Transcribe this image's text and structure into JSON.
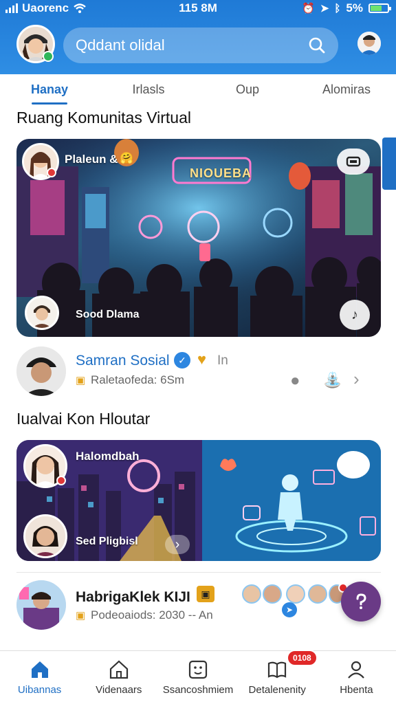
{
  "status_bar": {
    "carrier": "Uaorenc",
    "time": "115 8M",
    "battery": "5%"
  },
  "header": {
    "search_placeholder": "Qddant olidal"
  },
  "tabs": [
    {
      "label": "Hanay",
      "active": true
    },
    {
      "label": "Irlasls",
      "active": false
    },
    {
      "label": "Oup",
      "active": false
    },
    {
      "label": "Alomiras",
      "active": false
    }
  ],
  "sections": {
    "first_title": "Ruang Komunitas Virtual",
    "second_title": "Iualvai Kon Hloutar"
  },
  "card1": {
    "top_label": "Plaleun &",
    "bottom_label": "Sood Dlama",
    "neon_sign": "NIOUEBA"
  },
  "profile_row1": {
    "name": "Samran Sosial",
    "name_suffix": "In",
    "subtitle": "Raletaofeda: 6Sm"
  },
  "card2": {
    "top_label": "Halomdbah",
    "bottom_label": "Sed Pligbisl"
  },
  "profile_row2": {
    "name": "HabrigaKlek KIJI",
    "subtitle": "Podeoaiods: 2030 -- An"
  },
  "bottom_nav": [
    {
      "label": "Uibannas",
      "icon": "home-icon",
      "active": true
    },
    {
      "label": "Videnaars",
      "icon": "house-outline-icon",
      "active": false
    },
    {
      "label": "Ssancoshmiem",
      "icon": "smiley-box-icon",
      "active": false
    },
    {
      "label": "Detalenenity",
      "icon": "book-icon",
      "active": false,
      "badge": "0108"
    },
    {
      "label": "Hbenta",
      "icon": "person-icon",
      "active": false
    }
  ],
  "colors": {
    "header_blue": "#1f7ad6",
    "accent": "#1f6fc4",
    "fab": "#6a3a86",
    "badge": "#e02828"
  }
}
